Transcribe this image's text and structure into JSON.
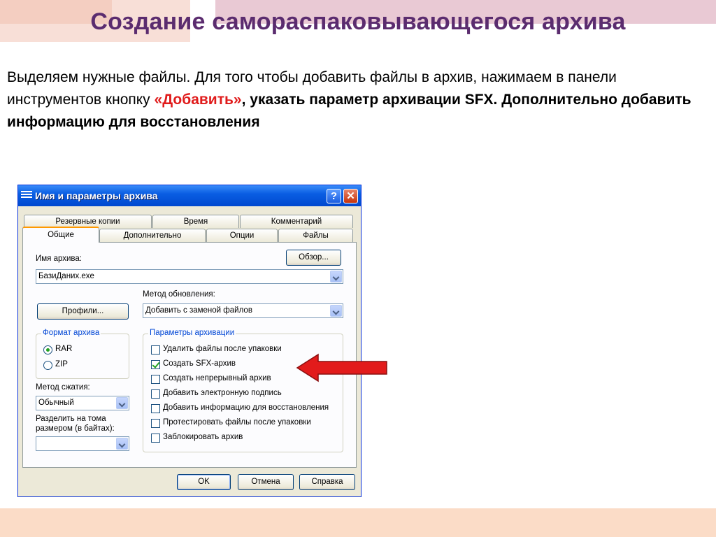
{
  "slide": {
    "title": "Создание самораспаковывающегося архива",
    "paragraph": {
      "part1": "Выделяем нужные файлы. Для того чтобы добавить файлы в архив, нажимаем в панели инструментов кнопку ",
      "highlight": "«Добавить»",
      "part2": ",  указать параметр архивации SFX. Дополнительно добавить информацию для восстановления"
    }
  },
  "dialog": {
    "title": "Имя и параметры архива",
    "tabs_row1": [
      "Резервные копии",
      "Время",
      "Комментарий"
    ],
    "tabs_row2": [
      "Общие",
      "Дополнительно",
      "Опции",
      "Файлы"
    ],
    "archive_name_label": "Имя архива:",
    "archive_name_value": "БазиДаних.exe",
    "browse_button": "Обзор...",
    "update_method_label": "Метод обновления:",
    "update_method_value": "Добавить с заменой файлов",
    "profiles_button": "Профили...",
    "format_group": "Формат архива",
    "formats": [
      {
        "label": "RAR",
        "selected": true
      },
      {
        "label": "ZIP",
        "selected": false
      }
    ],
    "compression_label": "Метод сжатия:",
    "compression_value": "Обычный",
    "split_label_1": "Разделить на тома",
    "split_label_2": "размером (в байтах):",
    "split_value": "",
    "params_group": "Параметры архивации",
    "options": [
      {
        "label": "Удалить файлы после упаковки",
        "checked": false
      },
      {
        "label": "Создать SFX-архив",
        "checked": true
      },
      {
        "label": "Создать непрерывный архив",
        "checked": false
      },
      {
        "label": "Добавить электронную подпись",
        "checked": false
      },
      {
        "label": "Добавить информацию для восстановления",
        "checked": false
      },
      {
        "label": "Протестировать файлы после упаковки",
        "checked": false
      },
      {
        "label": "Заблокировать архив",
        "checked": false
      }
    ],
    "ok_button": "OK",
    "cancel_button": "Отмена",
    "help_button": "Справка",
    "help_glyph": "?",
    "close_glyph": "✕"
  },
  "colors": {
    "title": "#5b2c6f",
    "highlight": "#e01b1b",
    "arrow": "#e21b1b"
  }
}
